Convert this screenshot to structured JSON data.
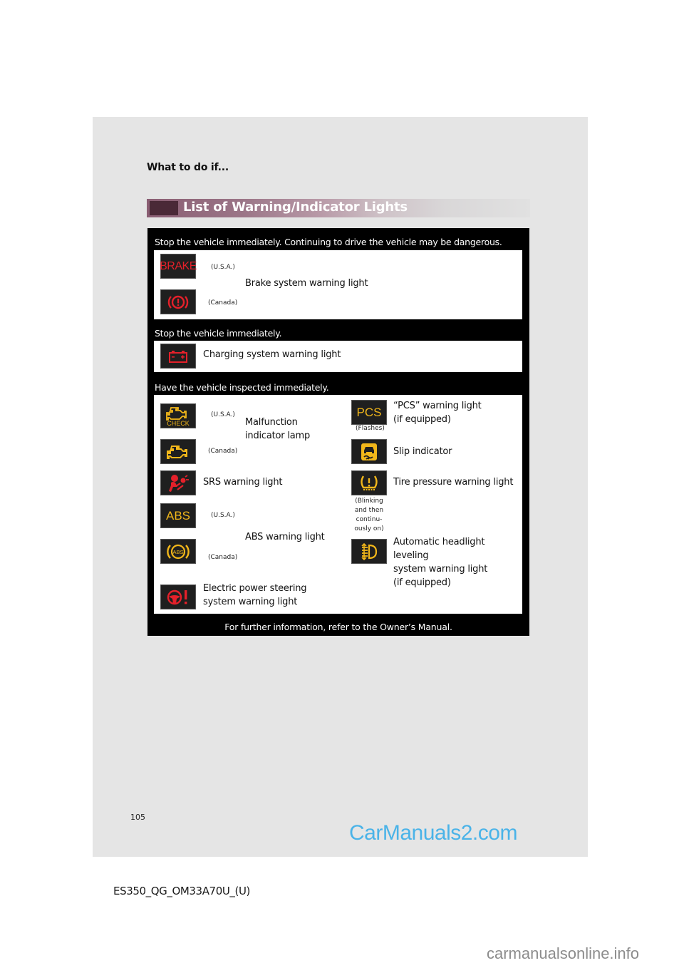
{
  "header": {
    "section": "What to do if...",
    "title": "List of Warning/Indicator Lights"
  },
  "colors": {
    "red": "#e4202a",
    "amber": "#f2b71a",
    "title_bar": "#8a5e73",
    "watermark": "#4ab3e8"
  },
  "groups": [
    {
      "heading": "Stop the vehicle immediately. Continuing to drive the vehicle may be dangerous.",
      "items": [
        {
          "label": "Brake system warning light",
          "variants": [
            {
              "icon": "brake-text-icon",
              "icon_text": "BRAKE",
              "region": "(U.S.A.)"
            },
            {
              "icon": "brake-circle-icon",
              "region": "(Canada)"
            }
          ]
        }
      ]
    },
    {
      "heading": "Stop the vehicle immediately.",
      "items": [
        {
          "label": "Charging system warning light",
          "icon": "battery-icon"
        }
      ]
    },
    {
      "heading": "Have the vehicle inspected immediately.",
      "left": [
        {
          "label": "Malfunction indicator lamp",
          "label_lines": [
            "Malfunction",
            "indicator lamp"
          ],
          "variants": [
            {
              "icon": "check-engine-icon",
              "icon_text": "CHECK",
              "region": "(U.S.A.)"
            },
            {
              "icon": "engine-icon",
              "region": "(Canada)"
            }
          ]
        },
        {
          "label": "SRS warning light",
          "icon": "airbag-icon"
        },
        {
          "label": "ABS warning light",
          "variants": [
            {
              "icon": "abs-text-icon",
              "icon_text": "ABS",
              "region": "(U.S.A.)"
            },
            {
              "icon": "abs-circle-icon",
              "icon_text": "ABS",
              "region": "(Canada)"
            }
          ]
        },
        {
          "label": "Electric power steering system warning light",
          "label_lines": [
            "Electric power steering",
            "system warning light"
          ],
          "icon": "steering-warning-icon"
        }
      ],
      "right": [
        {
          "label": "“PCS” warning light (if equipped)",
          "label_lines": [
            "“PCS” warning light",
            "(if equipped)"
          ],
          "icon": "pcs-icon",
          "icon_text": "PCS",
          "note": "(Flashes)"
        },
        {
          "label": "Slip indicator",
          "icon": "slip-icon"
        },
        {
          "label": "Tire pressure warning light",
          "icon": "tire-pressure-icon",
          "note_lines": [
            "(Blinking",
            "and then",
            "continu-",
            "ously on)"
          ]
        },
        {
          "label": "Automatic headlight leveling system warning light (if equipped)",
          "label_lines": [
            "Automatic headlight leveling",
            "system warning light",
            "(if equipped)"
          ],
          "icon": "headlight-leveling-icon"
        }
      ]
    }
  ],
  "footer_note": "For further information, refer to the Owner’s Manual.",
  "page_number": "105",
  "doc_code": "ES350_QG_OM33A70U_(U)",
  "watermarks": [
    "CarManuals2.com",
    "carmanualsonline.info"
  ]
}
